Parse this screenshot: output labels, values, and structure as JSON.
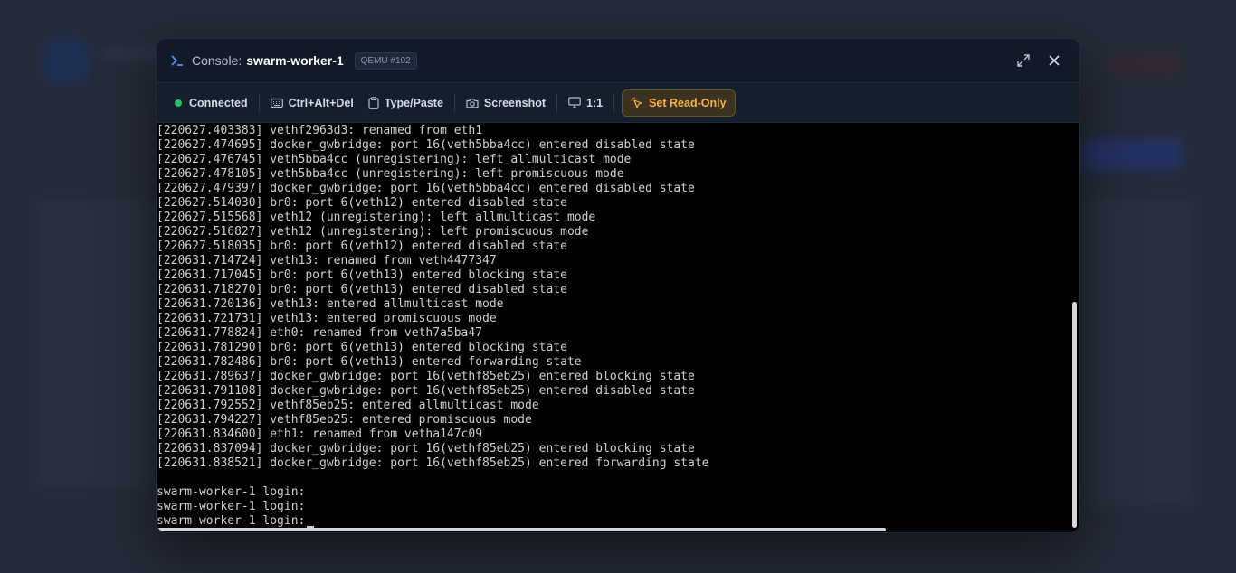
{
  "window": {
    "title_label": "Console:",
    "host": "swarm-worker-1",
    "badge": "QEMU #102"
  },
  "toolbar": {
    "status": "Connected",
    "ctrl_alt_del": "Ctrl+Alt+Del",
    "type_paste": "Type/Paste",
    "screenshot": "Screenshot",
    "scale": "1:1",
    "read_only": "Set Read-Only"
  },
  "colors": {
    "status_connected": "#22c55e",
    "accent_warning": "#f5b544",
    "prompt_icon": "#5b8cff"
  },
  "icons": {
    "title": "terminal-prompt-icon",
    "expand": "expand-icon",
    "close": "close-icon",
    "keyboard": "keyboard-icon",
    "clipboard": "clipboard-icon",
    "camera": "camera-icon",
    "monitor": "monitor-icon",
    "cursor": "cursor-click-icon"
  },
  "terminal": {
    "lines": [
      "[220627.403383] vethf2963d3: renamed from eth1",
      "[220627.474695] docker_gwbridge: port 16(veth5bba4cc) entered disabled state",
      "[220627.476745] veth5bba4cc (unregistering): left allmulticast mode",
      "[220627.478105] veth5bba4cc (unregistering): left promiscuous mode",
      "[220627.479397] docker_gwbridge: port 16(veth5bba4cc) entered disabled state",
      "[220627.514030] br0: port 6(veth12) entered disabled state",
      "[220627.515568] veth12 (unregistering): left allmulticast mode",
      "[220627.516827] veth12 (unregistering): left promiscuous mode",
      "[220627.518035] br0: port 6(veth12) entered disabled state",
      "[220631.714724] veth13: renamed from veth4477347",
      "[220631.717045] br0: port 6(veth13) entered blocking state",
      "[220631.718270] br0: port 6(veth13) entered disabled state",
      "[220631.720136] veth13: entered allmulticast mode",
      "[220631.721731] veth13: entered promiscuous mode",
      "[220631.778824] eth0: renamed from veth7a5ba47",
      "[220631.781290] br0: port 6(veth13) entered blocking state",
      "[220631.782486] br0: port 6(veth13) entered forwarding state",
      "[220631.789637] docker_gwbridge: port 16(vethf85eb25) entered blocking state",
      "[220631.791108] docker_gwbridge: port 16(vethf85eb25) entered disabled state",
      "[220631.792552] vethf85eb25: entered allmulticast mode",
      "[220631.794227] vethf85eb25: entered promiscuous mode",
      "[220631.834600] eth1: renamed from vetha147c09",
      "[220631.837094] docker_gwbridge: port 16(vethf85eb25) entered blocking state",
      "[220631.838521] docker_gwbridge: port 16(vethf85eb25) entered forwarding state",
      "",
      "swarm-worker-1 login:",
      "swarm-worker-1 login:",
      "swarm-worker-1 login:"
    ]
  }
}
